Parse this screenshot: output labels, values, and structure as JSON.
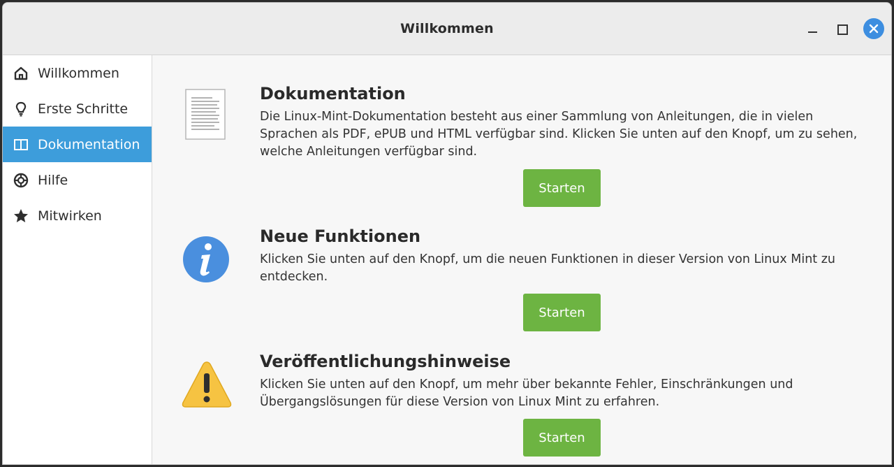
{
  "window": {
    "title": "Willkommen"
  },
  "sidebar": {
    "items": [
      {
        "label": "Willkommen",
        "icon": "home-icon",
        "active": false
      },
      {
        "label": "Erste Schritte",
        "icon": "lightbulb-icon",
        "active": false
      },
      {
        "label": "Dokumentation",
        "icon": "book-icon",
        "active": true
      },
      {
        "label": "Hilfe",
        "icon": "lifebuoy-icon",
        "active": false
      },
      {
        "label": "Mitwirken",
        "icon": "star-icon",
        "active": false
      }
    ]
  },
  "sections": [
    {
      "title": "Dokumentation",
      "description": "Die Linux-Mint-Dokumentation besteht aus einer Sammlung von Anleitungen, die in vielen Sprachen als PDF, ePUB und HTML verfügbar sind. Klicken Sie unten auf den Knopf, um zu sehen, welche Anleitungen verfügbar sind.",
      "button": "Starten",
      "icon": "document-icon"
    },
    {
      "title": "Neue Funktionen",
      "description": "Klicken Sie unten auf den Knopf, um die neuen Funktionen in dieser Version von Linux Mint zu entdecken.",
      "button": "Starten",
      "icon": "info-icon"
    },
    {
      "title": "Veröffentlichungshinweise",
      "description": "Klicken Sie unten auf den Knopf, um mehr über bekannte Fehler, Einschränkungen und Übergangslösungen für diese Version von Linux Mint zu erfahren.",
      "button": "Starten",
      "icon": "warning-icon"
    }
  ],
  "colors": {
    "accent": "#3d9ddb",
    "button": "#6db442",
    "close": "#3d8ee0"
  }
}
